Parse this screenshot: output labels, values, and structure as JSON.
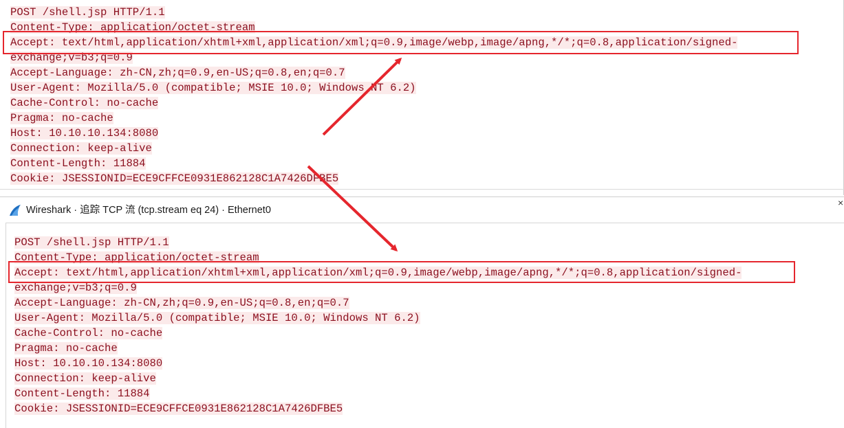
{
  "top_request": {
    "lines": [
      "POST /shell.jsp HTTP/1.1",
      "Content-Type: application/octet-stream",
      "Accept: text/html,application/xhtml+xml,application/xml;q=0.9,image/webp,image/apng,*/*;q=0.8,application/signed-",
      "exchange;v=b3;q=0.9",
      "Accept-Language: zh-CN,zh;q=0.9,en-US;q=0.8,en;q=0.7",
      "User-Agent: Mozilla/5.0 (compatible; MSIE 10.0; Windows NT 6.2)",
      "Cache-Control: no-cache",
      "Pragma: no-cache",
      "Host: 10.10.10.134:8080",
      "Connection: keep-alive",
      "Content-Length: 11884",
      "Cookie: JSESSIONID=ECE9CFFCE0931E862128C1A7426DFBE5"
    ]
  },
  "window": {
    "title": "Wireshark · 追踪 TCP 流 (tcp.stream eq 24) · Ethernet0",
    "app_icon": "wireshark-fin-icon",
    "close_glyph": "×"
  },
  "bottom_request": {
    "lines": [
      "POST /shell.jsp HTTP/1.1",
      "Content-Type: application/octet-stream",
      "Accept: text/html,application/xhtml+xml,application/xml;q=0.9,image/webp,image/apng,*/*;q=0.8,application/signed-",
      "exchange;v=b3;q=0.9",
      "Accept-Language: zh-CN,zh;q=0.9,en-US;q=0.8,en;q=0.7",
      "User-Agent: Mozilla/5.0 (compatible; MSIE 10.0; Windows NT 6.2)",
      "Cache-Control: no-cache",
      "Pragma: no-cache",
      "Host: 10.10.10.134:8080",
      "Connection: keep-alive",
      "Content-Length: 11884",
      "Cookie: JSESSIONID=ECE9CFFCE0931E862128C1A7426DFBE5"
    ]
  },
  "colors": {
    "request_text": "#8b0f1e",
    "request_bg": "#fbeaea",
    "annotation": "#e5262d"
  }
}
